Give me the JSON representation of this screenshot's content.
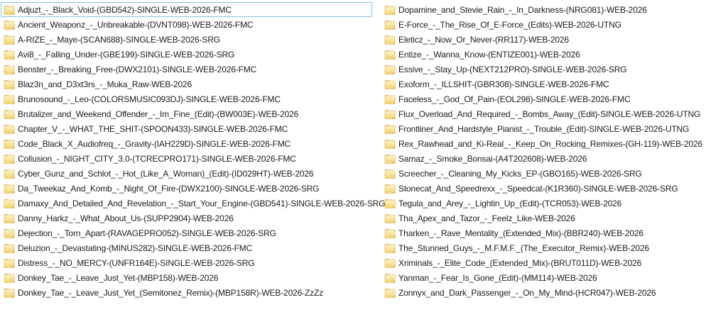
{
  "file_list": {
    "view": "list",
    "background_color": "#ffffff",
    "text_color": "#1b1b1b",
    "selection": {
      "column": 0,
      "index": 0,
      "border_color": "#86c5ea",
      "fill_color": "#fdfeff"
    },
    "folder_icon": {
      "name": "folder-icon",
      "tab_color": "#e0ae4e",
      "body_top_color": "#fdf4cb",
      "body_bottom_color": "#f2d26d",
      "outline_color": "#dcab4d",
      "fold_color": "#e5b854"
    },
    "columns": [
      {
        "items": [
          "Adjuzt_-_Black_Void-(GBD542)-SINGLE-WEB-2026-FMC",
          "Ancient_Weaponz_-_Unbreakable-(DVNT098)-WEB-2026-FMC",
          "A-RIZE_-_Maye-(SCAN688)-SINGLE-WEB-2026-SRG",
          "Avi8_-_Falling_Under-(GBE199)-SINGLE-WEB-2026-SRG",
          "Benster_-_Breaking_Free-(DWX2101)-SINGLE-WEB-2026-FMC",
          "Blaz3n_and_D3xt3rs_-_Muka_Raw-WEB-2026",
          "Brunosound_-_Leo-(COLORSMUSIC093DJ)-SINGLE-WEB-2026-FMC",
          "Brutalizer_and_Weekend_Offender_-_Im_Fine_(Edit)-(BW003E)-WEB-2026",
          "Chapter_V_-_WHAT_THE_SHIT-(SPOON433)-SINGLE-WEB-2026-FMC",
          "Code_Black_X_Audiofreq_-_Gravity-(IAH229D)-SINGLE-WEB-2026-FMC",
          "Collusion_-_NIGHT_CITY_3.0-(TCRECPRO171)-SINGLE-WEB-2026-FMC",
          "Cyber_Gunz_and_Schlot_-_Hot_(Like_A_Woman)_(Edit)-(ID029HT)-WEB-2026",
          "Da_Tweekaz_And_Komb_-_Night_Of_Fire-(DWX2100)-SINGLE-WEB-2026-SRG",
          "Damaxy_And_Detailed_And_Revelation_-_Start_Your_Engine-(GBD541)-SINGLE-WEB-2026-SRG",
          "Danny_Harkz_-_What_About_Us-(SUPP2904)-WEB-2026",
          "Dejection_-_Torn_Apart-(RAVAGEPRO052)-SINGLE-WEB-2026-SRG",
          "Deluzion_-_Devastating-(MINUS282)-SINGLE-WEB-2026-FMC",
          "Distress_-_NO_MERCY-(UNFR164E)-SINGLE-WEB-2026-SRG",
          "Donkey_Tae_-_Leave_Just_Yet-(MBP158)-WEB-2026",
          "Donkey_Tae_-_Leave_Just_Yet_(Semitonez_Remix)-(MBP158R)-WEB-2026-ZzZz"
        ]
      },
      {
        "items": [
          "Dopamine_and_Stevie_Rain_-_In_Darkness-(NRG081)-WEB-2026",
          "E-Force_-_The_Rise_Of_E-Force_(Edits)-WEB-2026-UTNG",
          "Eleticz_-_Now_Or_Never-(RR117)-WEB-2026",
          "Entize_-_Wanna_Know-(ENTIZE001)-WEB-2026",
          "Essive_-_Stay_Up-(NEXT212PRO)-SINGLE-WEB-2026-SRG",
          "Exoform_-_ILLSHIT-(GBR308)-SINGLE-WEB-2026-FMC",
          "Faceless_-_God_Of_Pain-(EOL298)-SINGLE-WEB-2026-FMC",
          "Flux_Overload_And_Required_-_Bombs_Away_(Edit)-SINGLE-WEB-2026-UTNG",
          "Frontliner_And_Hardstyle_Pianist_-_Trouble_(Edit)-SINGLE-WEB-2026-UTNG",
          "Rex_Rawhead_and_Ki-Real_-_Keep_On_Rocking_Remixes-(GH-119)-WEB-2026",
          "Samaz_-_Smoke_Bonsai-(A4T202608)-WEB-2026",
          "Screecher_-_Cleaning_My_Kicks_EP-(GBO165)-WEB-2026-SRG",
          "Stonecat_And_Speedrexx_-_Speedcat-(K1R360)-SINGLE-WEB-2026-SRG",
          "Tegula_and_Arey_-_Lightin_Up_(Edit)-(TCR053)-WEB-2026",
          "Tha_Apex_and_Tazor_-_Feelz_Like-WEB-2026",
          "Tharken_-_Rave_Mentality_(Extended_Mix)-(BBR240)-WEB-2026",
          "The_Stunned_Guys_-_M.F.M.F._(The_Executor_Remix)-WEB-2026",
          "Xriminals_-_Elite_Code_(Extended_Mix)-(BRUT011D)-WEB-2026",
          "Yanman_-_Fear_Is_Gone_(Edit)-(MM114)-WEB-2026",
          "Zonnyx_and_Dark_Passenger_-_On_My_Mind-(HCR047)-WEB-2026"
        ]
      }
    ]
  }
}
